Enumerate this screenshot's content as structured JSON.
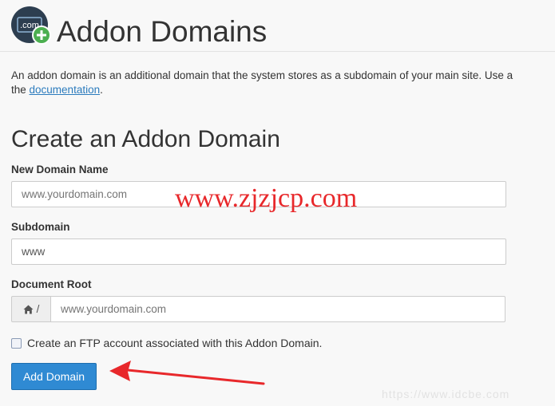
{
  "header": {
    "icon_text": ".com",
    "title": "Addon Domains"
  },
  "description": {
    "line1": "An addon domain is an additional domain that the system stores as a subdomain of your main site. Use a",
    "line2_prefix": "the ",
    "link_text": "documentation",
    "line2_suffix": "."
  },
  "form": {
    "section_title": "Create an Addon Domain",
    "new_domain": {
      "label": "New Domain Name",
      "placeholder": "www.yourdomain.com"
    },
    "subdomain": {
      "label": "Subdomain",
      "value": "www"
    },
    "document_root": {
      "label": "Document Root",
      "addon_icon": "home-icon",
      "addon_text": "/",
      "placeholder": "www.yourdomain.com"
    },
    "ftp_checkbox_label": "Create an FTP account associated with this Addon Domain.",
    "submit_label": "Add Domain"
  },
  "watermarks": {
    "main": "www.zjzjcp.com",
    "bottom": "https://www.idcbe.com"
  },
  "colors": {
    "accent": "#2f8ad3",
    "link": "#2b7bbd",
    "annotation_red": "#e8282b",
    "icon_green": "#4caf50",
    "icon_dark": "#2d3e50"
  }
}
